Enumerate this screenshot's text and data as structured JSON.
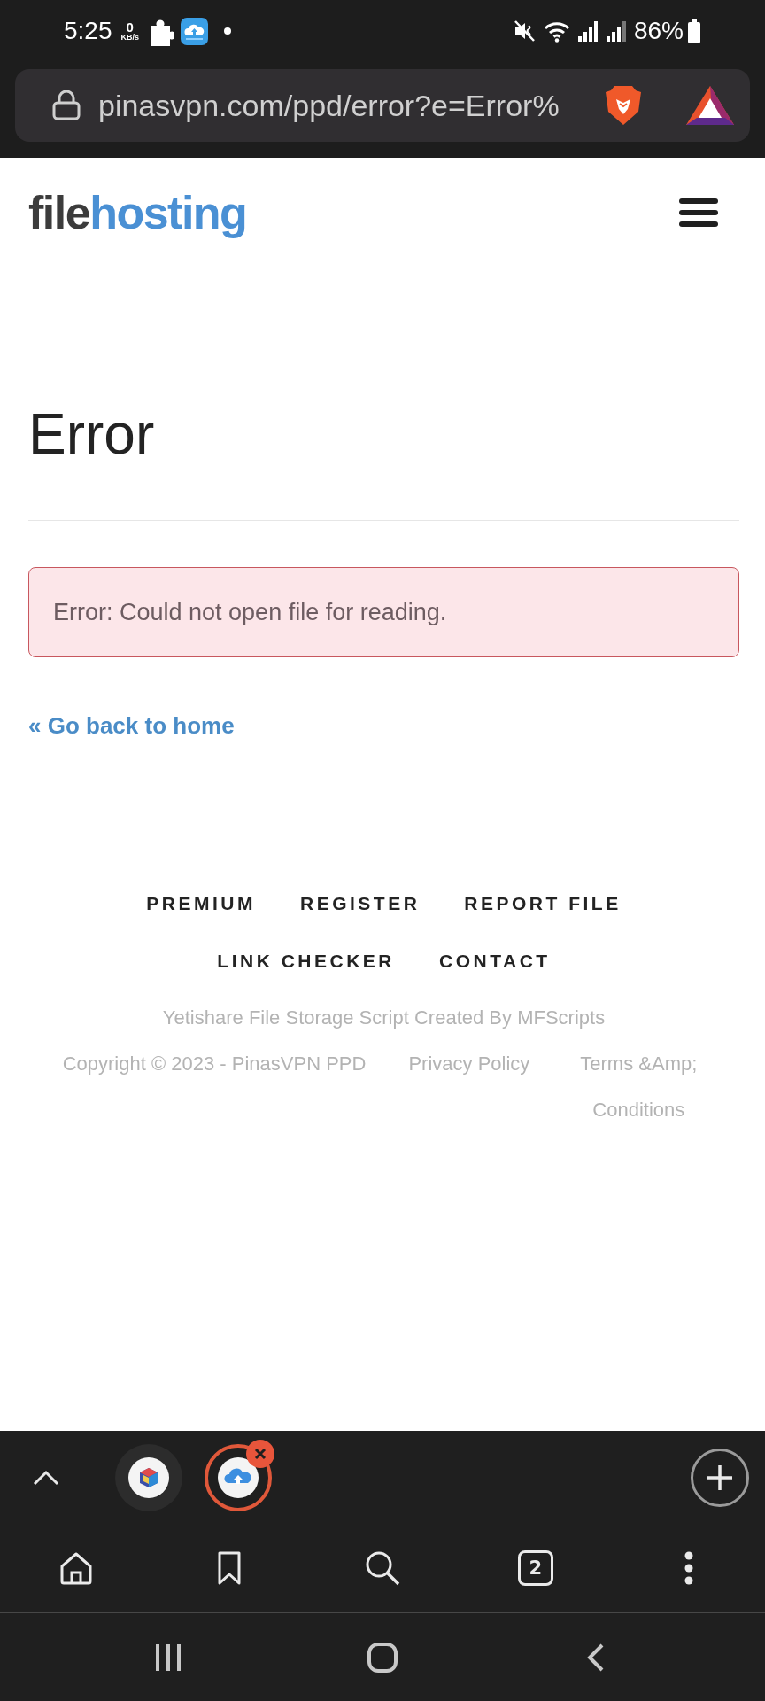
{
  "status_bar": {
    "time": "5:25",
    "net_speed": "0",
    "net_speed_unit": "KB/s",
    "battery": "86%"
  },
  "address_bar": {
    "url": "pinasvpn.com/ppd/error?e=Error%"
  },
  "site_header": {
    "logo": {
      "dark_part": "file",
      "accent_part": "hosting"
    }
  },
  "page": {
    "title": "Error",
    "alert": "Error: Could not open file for reading.",
    "back_link": "« Go back to home"
  },
  "footer": {
    "nav": [
      "PREMIUM",
      "REGISTER",
      "REPORT FILE",
      "LINK CHECKER",
      "CONTACT"
    ],
    "credit": "Yetishare File Storage Script Created By MFScripts",
    "copyright": "Copyright © 2023 - PinasVPN PPD",
    "links": [
      "Privacy Policy",
      "Terms &Amp; Conditions"
    ]
  },
  "tab_strip": {
    "tabs": [
      {
        "selected": false
      },
      {
        "selected": true
      }
    ]
  },
  "toolbar": {
    "tab_count": "2"
  }
}
